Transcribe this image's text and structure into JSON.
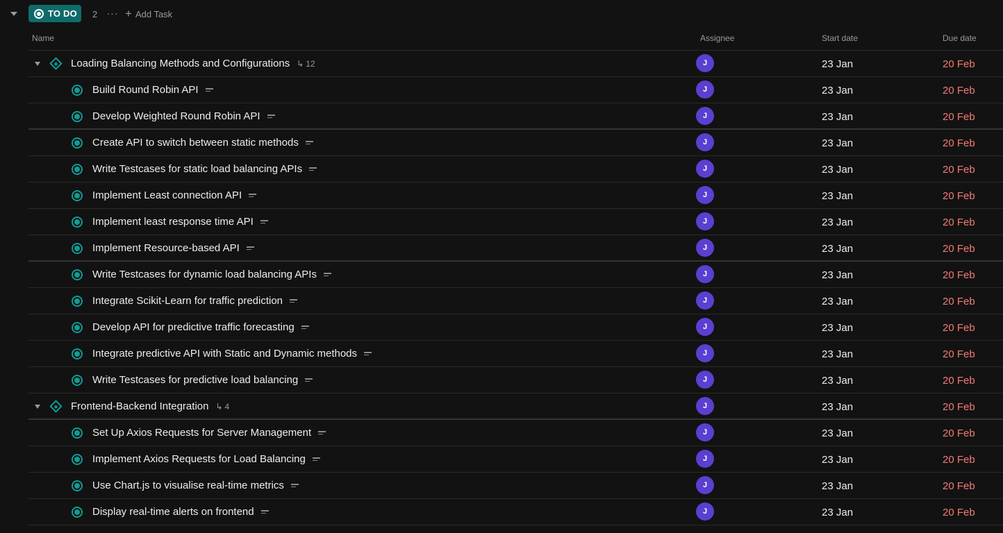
{
  "group": {
    "status_label": "TO DO",
    "count": "2",
    "more_label": "···",
    "add_task_label": "Add Task",
    "accent_color": "#0f6b6b"
  },
  "columns": {
    "name": "Name",
    "assignee": "Assignee",
    "start_date": "Start date",
    "due_date": "Due date"
  },
  "rows": [
    {
      "type": "parent",
      "name": "Loading Balancing Methods and Configurations",
      "subtasks": "12",
      "assignee": "J",
      "start": "23 Jan",
      "due": "20 Feb"
    },
    {
      "type": "child",
      "name": "Build Round Robin API",
      "assignee": "J",
      "start": "23 Jan",
      "due": "20 Feb"
    },
    {
      "type": "child",
      "name": "Develop Weighted Round Robin API",
      "assignee": "J",
      "start": "23 Jan",
      "due": "20 Feb"
    },
    {
      "type": "child",
      "name": "Create API to switch between static methods",
      "assignee": "J",
      "start": "23 Jan",
      "due": "20 Feb"
    },
    {
      "type": "child",
      "name": "Write Testcases for static load balancing APIs",
      "assignee": "J",
      "start": "23 Jan",
      "due": "20 Feb"
    },
    {
      "type": "child",
      "name": "Implement Least connection API",
      "assignee": "J",
      "start": "23 Jan",
      "due": "20 Feb"
    },
    {
      "type": "child",
      "name": "Implement least response time API",
      "assignee": "J",
      "start": "23 Jan",
      "due": "20 Feb"
    },
    {
      "type": "child",
      "name": "Implement Resource-based API",
      "assignee": "J",
      "start": "23 Jan",
      "due": "20 Feb"
    },
    {
      "type": "child",
      "name": "Write Testcases for dynamic load balancing APIs",
      "assignee": "J",
      "start": "23 Jan",
      "due": "20 Feb"
    },
    {
      "type": "child",
      "name": "Integrate Scikit-Learn for traffic prediction",
      "assignee": "J",
      "start": "23 Jan",
      "due": "20 Feb"
    },
    {
      "type": "child",
      "name": "Develop API for predictive traffic forecasting",
      "assignee": "J",
      "start": "23 Jan",
      "due": "20 Feb"
    },
    {
      "type": "child",
      "name": "Integrate predictive API with Static and Dynamic methods",
      "assignee": "J",
      "start": "23 Jan",
      "due": "20 Feb"
    },
    {
      "type": "child",
      "name": "Write Testcases for predictive load balancing",
      "assignee": "J",
      "start": "23 Jan",
      "due": "20 Feb"
    },
    {
      "type": "parent",
      "name": "Frontend-Backend Integration",
      "subtasks": "4",
      "assignee": "J",
      "start": "23 Jan",
      "due": "20 Feb"
    },
    {
      "type": "child",
      "name": "Set Up Axios Requests for Server Management",
      "assignee": "J",
      "start": "23 Jan",
      "due": "20 Feb"
    },
    {
      "type": "child",
      "name": "Implement Axios Requests for Load Balancing",
      "assignee": "J",
      "start": "23 Jan",
      "due": "20 Feb"
    },
    {
      "type": "child",
      "name": "Use Chart.js to visualise real-time metrics",
      "assignee": "J",
      "start": "23 Jan",
      "due": "20 Feb"
    },
    {
      "type": "child",
      "name": "Display real-time alerts on frontend",
      "assignee": "J",
      "start": "23 Jan",
      "due": "20 Feb"
    }
  ],
  "colors": {
    "background": "#121212",
    "status_teal": "#129b92",
    "avatar_purple": "#5b3fd1",
    "due_red": "#f47c72"
  },
  "icons": {
    "collapse": "chevron-down-icon",
    "status": "status-circle-icon",
    "parent": "diamond-icon",
    "description": "description-icon",
    "subtasks": "subtask-icon",
    "add": "plus-icon",
    "more": "more-icon"
  }
}
